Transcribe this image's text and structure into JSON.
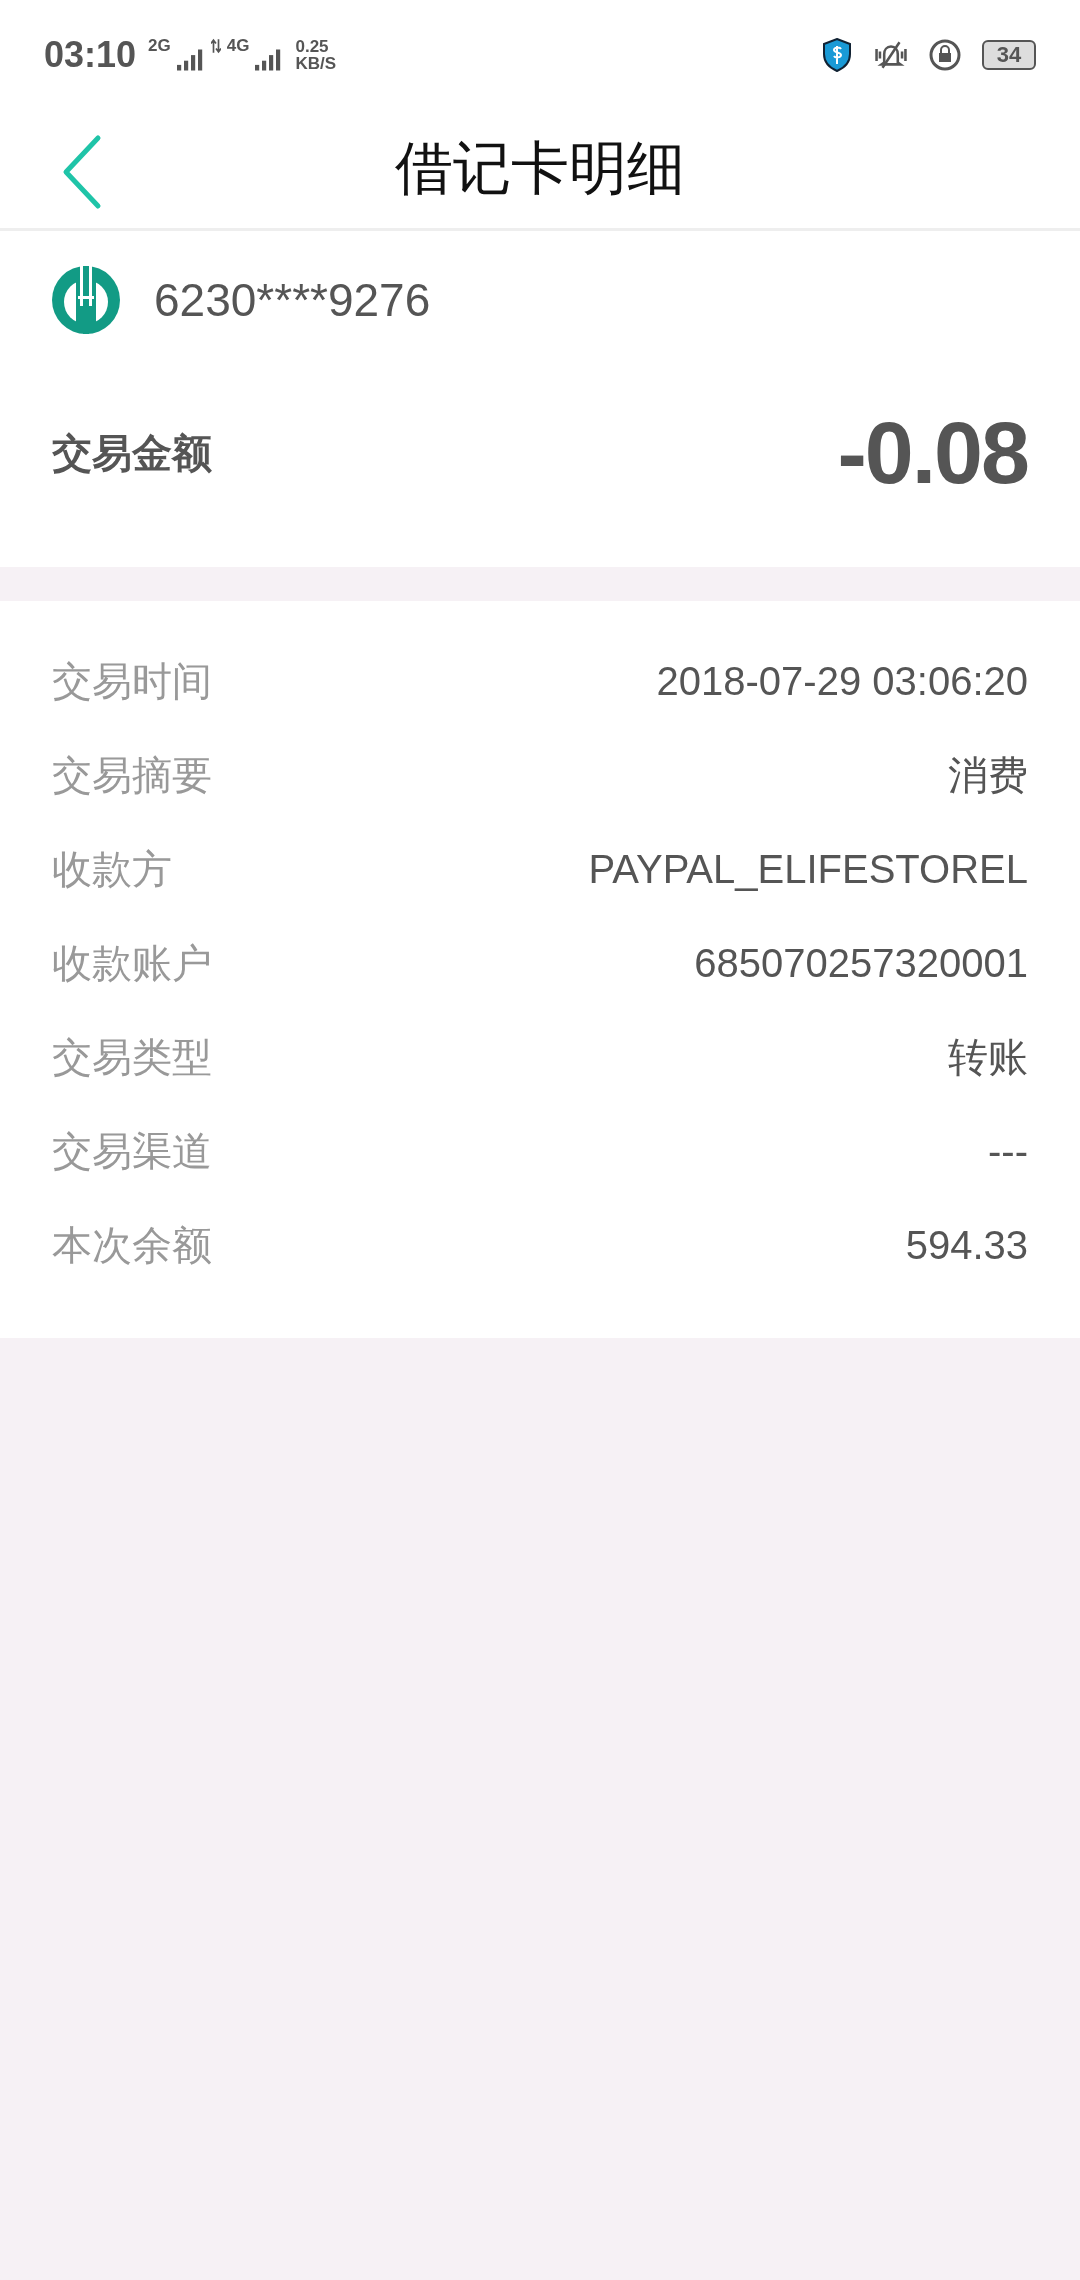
{
  "status_bar": {
    "time": "03:10",
    "network_1": "2G",
    "network_2": "4G",
    "speed_value": "0.25",
    "speed_unit": "KB/S",
    "battery": "34"
  },
  "header": {
    "title": "借记卡明细"
  },
  "card": {
    "number": "6230****9276",
    "amount_label": "交易金额",
    "amount": "-0.08"
  },
  "details": [
    {
      "label": "交易时间",
      "value": "2018-07-29 03:06:20"
    },
    {
      "label": "交易摘要",
      "value": "消费"
    },
    {
      "label": "收款方",
      "value": "PAYPAL_ELIFESTOREL"
    },
    {
      "label": "收款账户",
      "value": "685070257320001"
    },
    {
      "label": "交易类型",
      "value": "转账"
    },
    {
      "label": "交易渠道",
      "value": "---"
    },
    {
      "label": "本次余额",
      "value": "594.33"
    }
  ]
}
